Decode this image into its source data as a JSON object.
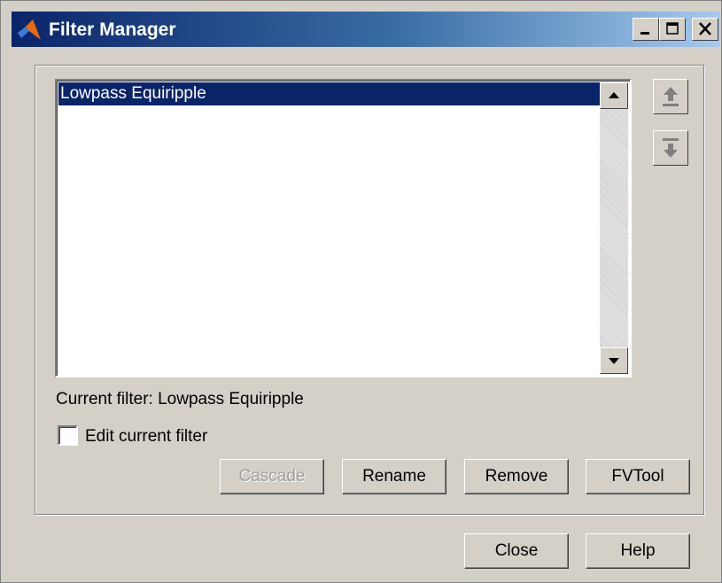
{
  "window": {
    "title": "Filter Manager",
    "icons": {
      "app": "matlab-logo-icon",
      "minimize": "minimize-icon",
      "maximize": "maximize-icon",
      "close": "close-icon"
    }
  },
  "filter_list": {
    "items": [
      "Lowpass Equiripple"
    ],
    "selected_index": 0
  },
  "side_buttons": {
    "move_up_icon": "move-up-icon",
    "move_down_icon": "move-down-icon"
  },
  "current_filter_label": "Current filter: Lowpass Equiripple",
  "edit_checkbox": {
    "label": "Edit current filter",
    "checked": false
  },
  "buttons": {
    "cascade": "Cascade",
    "rename": "Rename",
    "remove": "Remove",
    "fvtool": "FVTool",
    "close": "Close",
    "help": "Help"
  },
  "colors": {
    "selection": "#0a246a",
    "face": "#d4d0c8"
  }
}
